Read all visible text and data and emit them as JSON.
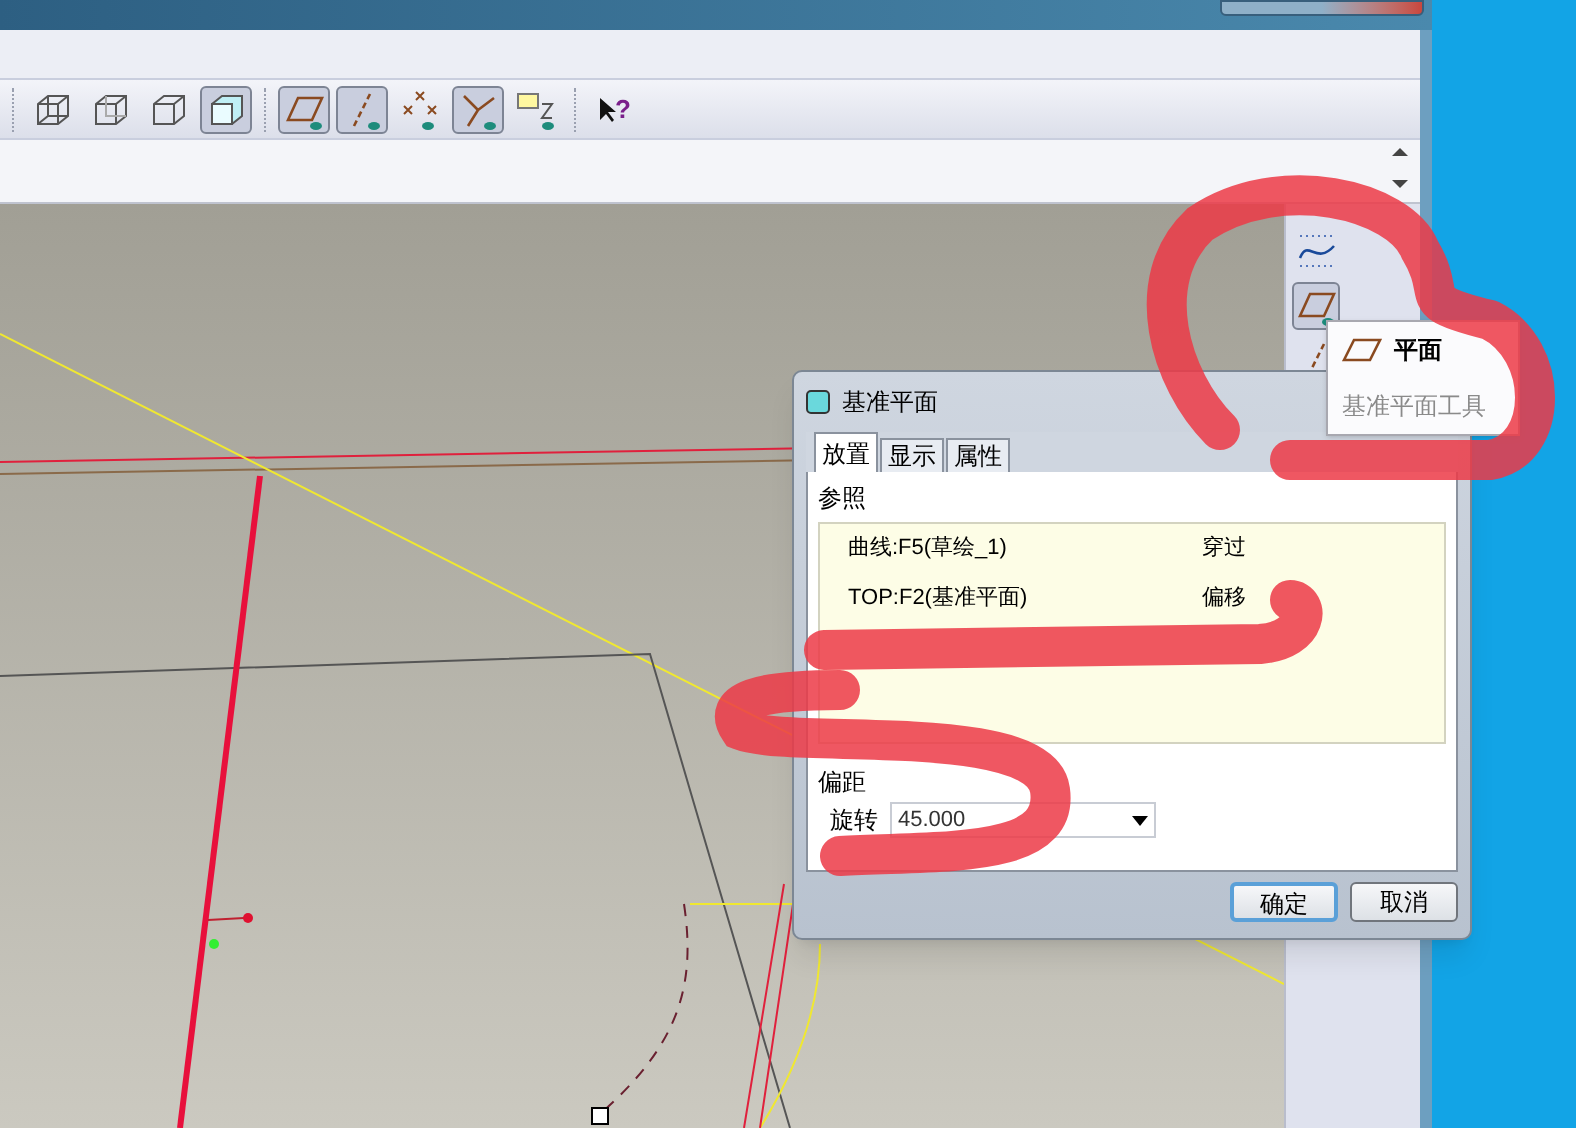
{
  "toolbar": {
    "buttons": [
      {
        "kind": "wireframe",
        "selected": false
      },
      {
        "kind": "hidden-line",
        "selected": false
      },
      {
        "kind": "no-hidden",
        "selected": false
      },
      {
        "kind": "shaded",
        "selected": true
      },
      {
        "kind": "datum-plane",
        "selected": true
      },
      {
        "kind": "datum-axis",
        "selected": true
      },
      {
        "kind": "datum-point",
        "selected": false
      },
      {
        "kind": "csys",
        "selected": true
      },
      {
        "kind": "annotation",
        "selected": false
      },
      {
        "kind": "help",
        "selected": false,
        "label": "?"
      }
    ]
  },
  "right_toolbar": {
    "buttons": [
      {
        "kind": "sketch-curve",
        "selected": false
      },
      {
        "kind": "datum-plane",
        "selected": true
      },
      {
        "kind": "datum-axis",
        "selected": false
      }
    ]
  },
  "tooltip": {
    "title": "平面",
    "description": "基准平面工具"
  },
  "dialog": {
    "title": "基准平面",
    "tabs": [
      {
        "label": "放置",
        "selected": true
      },
      {
        "label": "显示",
        "selected": false
      },
      {
        "label": "属性",
        "selected": false
      }
    ],
    "references_label": "参照",
    "references": [
      {
        "reference": "曲线:F5(草绘_1)",
        "constraint": "穿过"
      },
      {
        "reference": "TOP:F2(基准平面)",
        "constraint": "偏移"
      }
    ],
    "offset_label": "偏距",
    "offset_field_label": "旋转",
    "offset_value": "45.000",
    "buttons": [
      {
        "label": "确定",
        "default": true
      },
      {
        "label": "取消",
        "default": false
      }
    ]
  }
}
